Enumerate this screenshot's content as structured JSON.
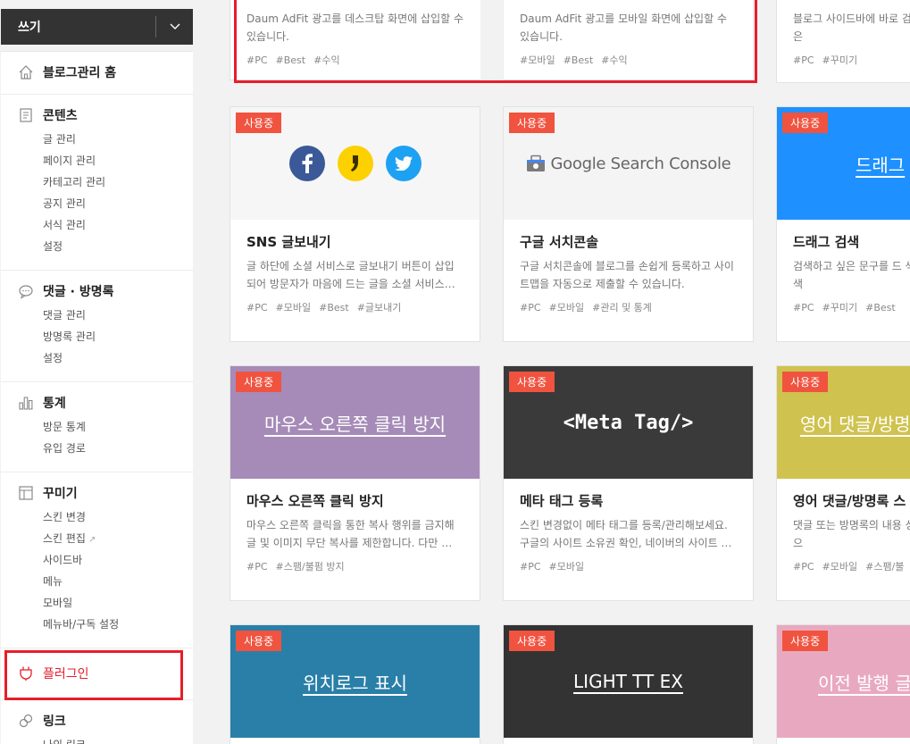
{
  "sidebar": {
    "write_label": "쓰기",
    "sections": [
      {
        "title": "블로그관리 홈",
        "icon": "home-icon",
        "items": []
      },
      {
        "title": "콘텐츠",
        "icon": "document-icon",
        "items": [
          "글 관리",
          "페이지 관리",
          "카테고리 관리",
          "공지 관리",
          "서식 관리",
          "설정"
        ]
      },
      {
        "title": "댓글 · 방명록",
        "icon": "comment-icon",
        "items": [
          "댓글 관리",
          "방명록 관리",
          "설정"
        ]
      },
      {
        "title": "통계",
        "icon": "bar-chart-icon",
        "items": [
          "방문 통계",
          "유입 경로"
        ]
      },
      {
        "title": "꾸미기",
        "icon": "layout-icon",
        "items": [
          "스킨 변경",
          "스킨 편집",
          "사이드바",
          "메뉴",
          "모바일",
          "메뉴바/구독 설정"
        ]
      },
      {
        "title": "플러그인",
        "icon": "plug-icon",
        "items": []
      },
      {
        "title": "링크",
        "icon": "link-icon",
        "items": [
          "나의 링크"
        ]
      }
    ],
    "ext_mark": "↗"
  },
  "colors": {
    "accent": "#f0533f",
    "highlight": "#e61e2b"
  },
  "top_cards": [
    {
      "desc": "Daum AdFit 광고를 데스크탑 화면에 삽입할 수 있습니다.",
      "tags": [
        "#PC",
        "#Best",
        "#수익"
      ]
    },
    {
      "desc": "Daum AdFit 광고를 모바일 화면에 삽입할 수 있습니다.",
      "tags": [
        "#모바일",
        "#Best",
        "#수익"
      ]
    },
    {
      "desc": "블로그 사이드바에 바로 검색창을 표시합니다. 은",
      "tags": [
        "#PC",
        "#꾸미기"
      ]
    }
  ],
  "cards": [
    {
      "badge": "사용중",
      "name": "SNS 글보내기",
      "desc": "글 하단에 소셜 서비스로 글보내기 버튼이 삽입되어 방문자가 마음에 드는 글을 소셜 서비스…",
      "tags": [
        "#PC",
        "#모바일",
        "#Best",
        "#글보내기"
      ]
    },
    {
      "badge": "사용중",
      "thumb_text": "Google Search Console",
      "name": "구글 서치콘솔",
      "desc": "구글 서치콘솔에 블로그를 손쉽게 등록하고 사이트맵을 자동으로 제출할 수 있습니다.",
      "tags": [
        "#PC",
        "#모바일",
        "#관리 및 통계"
      ]
    },
    {
      "badge": "사용중",
      "thumb_text": "드래그",
      "name": "드래그 검색",
      "desc": "검색하고 싶은 문구를 드 색 버튼이 나타나며 검색",
      "tags": [
        "#PC",
        "#꾸미기",
        "#Best"
      ]
    },
    {
      "badge": "사용중",
      "thumb_text": "마우스 오른쪽 클릭 방지",
      "name": "마우스 오른쪽 클릭 방지",
      "desc": "마우스 오른쪽 클릭을 통한 복사 행위를 금지해 글 및 이미지 무단 복사를 제한합니다. 다만 …",
      "tags": [
        "#PC",
        "#스팸/불펌 방지"
      ]
    },
    {
      "badge": "사용중",
      "thumb_text": "<Meta Tag/>",
      "name": "메타 태그 등록",
      "desc": "스킨 변경없이 메타 태그를 등록/관리해보세요. 구글의 사이트 소유권 확인, 네이버의 사이트 …",
      "tags": [
        "#PC",
        "#모바일"
      ]
    },
    {
      "badge": "사용중",
      "thumb_text": "영어 댓글/방명",
      "name": "영어 댓글/방명록 스",
      "desc": "댓글 또는 방명록의 내용 성되어 있을 경우, 스팸으",
      "tags": [
        "#PC",
        "#모바일",
        "#스팸/불"
      ]
    },
    {
      "badge": "사용중",
      "thumb_text": "위치로그 표시"
    },
    {
      "badge": "사용중",
      "thumb_text": "LIGHT TT EX"
    },
    {
      "badge": "사용중",
      "thumb_text": "이전 발행 글"
    }
  ]
}
